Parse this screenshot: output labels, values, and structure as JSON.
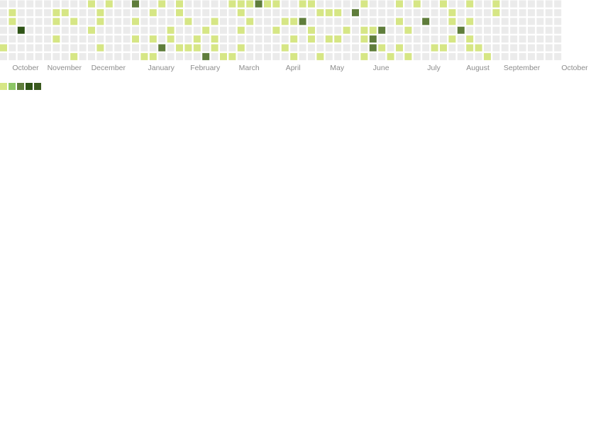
{
  "chart_data": {
    "type": "heatmap",
    "title": "",
    "rows": 7,
    "columns": 54,
    "first_column_start_row": 3,
    "colors": [
      "#ebebeb",
      "#d6e685",
      "#8cc665",
      "#5f7d3b",
      "#2f5416"
    ],
    "months": [
      {
        "label": "October",
        "col": 1
      },
      {
        "label": "November",
        "col": 7
      },
      {
        "label": "December",
        "col": 12
      },
      {
        "label": "January",
        "col": 18
      },
      {
        "label": "February",
        "col": 23
      },
      {
        "label": "March",
        "col": 28
      },
      {
        "label": "April",
        "col": 33
      },
      {
        "label": "May",
        "col": 38
      },
      {
        "label": "June",
        "col": 43
      },
      {
        "label": "July",
        "col": 49
      },
      {
        "label": "August",
        "col": 54
      },
      {
        "label": "September",
        "col": 59
      },
      {
        "label": "October",
        "col": 65
      }
    ],
    "active_cells": [
      [
        1,
        1,
        1
      ],
      [
        1,
        2,
        1
      ],
      [
        0,
        5,
        1
      ],
      [
        2,
        3,
        4
      ],
      [
        6,
        1,
        1
      ],
      [
        6,
        2,
        1
      ],
      [
        7,
        1,
        1
      ],
      [
        8,
        2,
        1
      ],
      [
        8,
        6,
        1
      ],
      [
        6,
        4,
        1
      ],
      [
        10,
        0,
        1
      ],
      [
        10,
        3,
        1
      ],
      [
        11,
        1,
        1
      ],
      [
        11,
        2,
        1
      ],
      [
        11,
        5,
        1
      ],
      [
        12,
        0,
        1
      ],
      [
        15,
        0,
        3
      ],
      [
        15,
        2,
        1
      ],
      [
        15,
        4,
        1
      ],
      [
        16,
        6,
        1
      ],
      [
        17,
        1,
        1
      ],
      [
        17,
        4,
        1
      ],
      [
        17,
        6,
        1
      ],
      [
        18,
        0,
        1
      ],
      [
        18,
        5,
        3
      ],
      [
        19,
        3,
        1
      ],
      [
        19,
        4,
        1
      ],
      [
        20,
        0,
        1
      ],
      [
        20,
        1,
        1
      ],
      [
        20,
        5,
        1
      ],
      [
        21,
        2,
        1
      ],
      [
        21,
        5,
        1
      ],
      [
        22,
        4,
        1
      ],
      [
        22,
        5,
        1
      ],
      [
        23,
        3,
        1
      ],
      [
        23,
        6,
        3
      ],
      [
        24,
        2,
        1
      ],
      [
        24,
        4,
        1
      ],
      [
        24,
        5,
        1
      ],
      [
        25,
        6,
        1
      ],
      [
        26,
        0,
        1
      ],
      [
        26,
        6,
        1
      ],
      [
        27,
        0,
        1
      ],
      [
        27,
        1,
        1
      ],
      [
        27,
        3,
        1
      ],
      [
        27,
        5,
        1
      ],
      [
        28,
        0,
        1
      ],
      [
        28,
        2,
        1
      ],
      [
        29,
        0,
        3
      ],
      [
        30,
        0,
        1
      ],
      [
        31,
        0,
        1
      ],
      [
        31,
        3,
        1
      ],
      [
        32,
        2,
        1
      ],
      [
        32,
        5,
        1
      ],
      [
        33,
        2,
        1
      ],
      [
        33,
        4,
        1
      ],
      [
        33,
        6,
        1
      ],
      [
        34,
        0,
        1
      ],
      [
        34,
        2,
        3
      ],
      [
        35,
        0,
        1
      ],
      [
        35,
        3,
        1
      ],
      [
        35,
        4,
        1
      ],
      [
        36,
        1,
        1
      ],
      [
        36,
        6,
        1
      ],
      [
        37,
        1,
        1
      ],
      [
        37,
        4,
        1
      ],
      [
        38,
        1,
        1
      ],
      [
        38,
        4,
        1
      ],
      [
        39,
        3,
        1
      ],
      [
        40,
        1,
        3
      ],
      [
        41,
        0,
        1
      ],
      [
        41,
        3,
        1
      ],
      [
        41,
        6,
        1
      ],
      [
        41,
        4,
        1
      ],
      [
        42,
        3,
        1
      ],
      [
        42,
        4,
        3
      ],
      [
        42,
        5,
        3
      ],
      [
        43,
        3,
        3
      ],
      [
        43,
        5,
        1
      ],
      [
        44,
        6,
        1
      ],
      [
        45,
        0,
        1
      ],
      [
        45,
        2,
        1
      ],
      [
        45,
        5,
        1
      ],
      [
        46,
        3,
        1
      ],
      [
        46,
        6,
        1
      ],
      [
        47,
        0,
        1
      ],
      [
        48,
        2,
        3
      ],
      [
        49,
        5,
        1
      ],
      [
        50,
        5,
        1
      ],
      [
        50,
        0,
        1
      ],
      [
        51,
        1,
        1
      ],
      [
        51,
        2,
        1
      ],
      [
        51,
        4,
        1
      ],
      [
        52,
        3,
        3
      ],
      [
        53,
        0,
        1
      ],
      [
        53,
        2,
        1
      ],
      [
        53,
        4,
        1
      ],
      [
        53,
        5,
        1
      ],
      [
        54,
        5,
        1
      ],
      [
        55,
        6,
        1
      ],
      [
        56,
        0,
        1
      ],
      [
        56,
        1,
        1
      ]
    ]
  },
  "legend": {
    "swatches": [
      {
        "name": "level-1",
        "color": "#d6e685"
      },
      {
        "name": "level-2",
        "color": "#8cc665"
      },
      {
        "name": "level-3",
        "color": "#5f7d3b"
      },
      {
        "name": "level-4",
        "color": "#2f5416"
      },
      {
        "name": "level-4b",
        "color": "#3a5a1e"
      }
    ]
  }
}
